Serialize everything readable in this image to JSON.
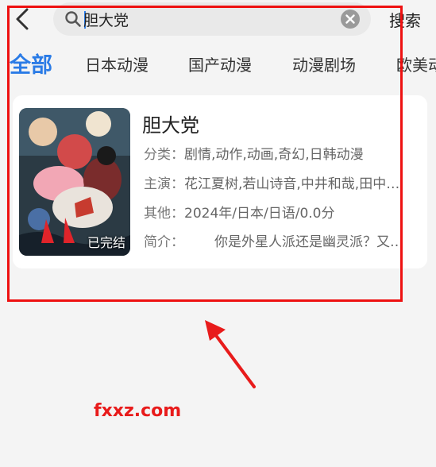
{
  "header": {
    "search_value": "胆大党",
    "search_button_label": "搜索"
  },
  "tabs": [
    {
      "label": "全部",
      "active": true
    },
    {
      "label": "日本动漫",
      "active": false
    },
    {
      "label": "国产动漫",
      "active": false
    },
    {
      "label": "动漫剧场",
      "active": false
    },
    {
      "label": "欧美动漫",
      "active": false
    }
  ],
  "result": {
    "title": "胆大党",
    "status_badge": "已完结",
    "category_label": "分类：",
    "category_value": "剧情,动作,动画,奇幻,日韩动漫",
    "cast_label": "主演：",
    "cast_value": "花江夏树,若山诗音,中井和哉,田中…",
    "other_label": "其他：",
    "other_value": "2024年/日本/日语/0.0分",
    "intro_label": "简介：",
    "intro_value": "你是外星人派还是幽灵派？又…"
  },
  "annotation": {
    "watermark": "fxxz.com",
    "highlight_color": "#ee1111"
  },
  "colors": {
    "accent": "#2a7be6",
    "background": "#f4f4f4"
  },
  "icons": [
    "back-arrow-icon",
    "search-icon",
    "clear-icon"
  ]
}
